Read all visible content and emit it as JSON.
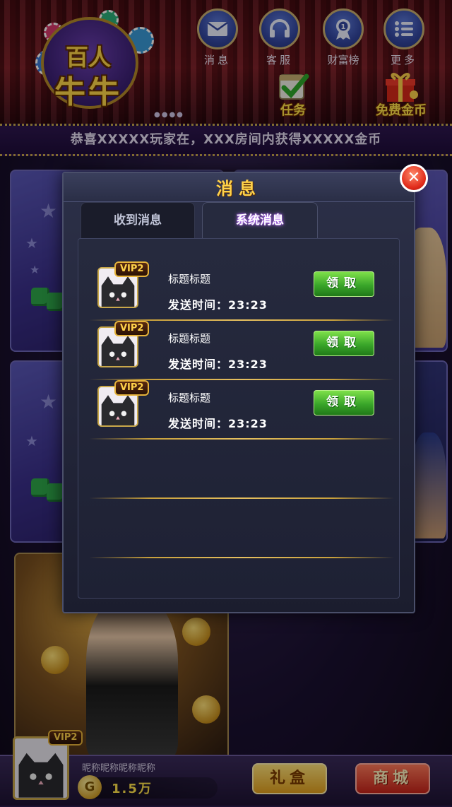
{
  "header": {
    "logo": {
      "line1": "百人",
      "line2": "牛牛"
    },
    "nav": [
      {
        "label": "消息",
        "icon": "mail-icon"
      },
      {
        "label": "客服",
        "icon": "headset-icon"
      },
      {
        "label": "财富榜",
        "icon": "medal-icon"
      },
      {
        "label": "更多",
        "icon": "list-icon"
      }
    ],
    "task_label": "任务",
    "free_coins_label": "免费金币"
  },
  "marquee": "恭喜XXXXX玩家在，XXX房间内获得XXXXX金币",
  "modal": {
    "title": "消息",
    "tabs": [
      {
        "label": "收到消息",
        "active": false
      },
      {
        "label": "系统消息",
        "active": true
      }
    ],
    "messages": [
      {
        "vip": "VIP2",
        "title": "标题标题",
        "time": "发送时间：23:23",
        "button": "领取"
      },
      {
        "vip": "VIP2",
        "title": "标题标题",
        "time": "发送时间：23:23",
        "button": "领取"
      },
      {
        "vip": "VIP2",
        "title": "标题标题",
        "time": "发送时间：23:23",
        "button": "领取"
      }
    ]
  },
  "player": {
    "vip": "VIP2",
    "nickname": "昵称昵称昵称昵称",
    "coins": "1.5万",
    "coin_symbol": "G"
  },
  "bottom": {
    "gift_label": "礼盒",
    "shop_label": "商城"
  },
  "colors": {
    "accent_gold": "#ffd24a",
    "claim_green": "#3aa62a",
    "close_red": "#e02a1a",
    "active_tab_glow": "#c27cff"
  }
}
